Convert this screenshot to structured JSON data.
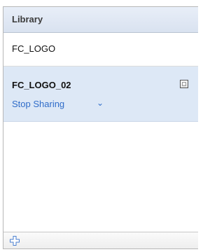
{
  "panel": {
    "title": "Library"
  },
  "items": [
    {
      "name": "FC_LOGO",
      "selected": false
    },
    {
      "name": "FC_LOGO_02",
      "selected": true,
      "action_label": "Stop Sharing"
    }
  ],
  "icons": {
    "checkbox": "square-checkbox-icon",
    "chevron": "double-chevron-down-icon",
    "add": "plus-icon"
  },
  "colors": {
    "header_bg": "#dde5f2",
    "selected_row_bg": "#dde8f6",
    "link_blue": "#2f6cc9"
  }
}
